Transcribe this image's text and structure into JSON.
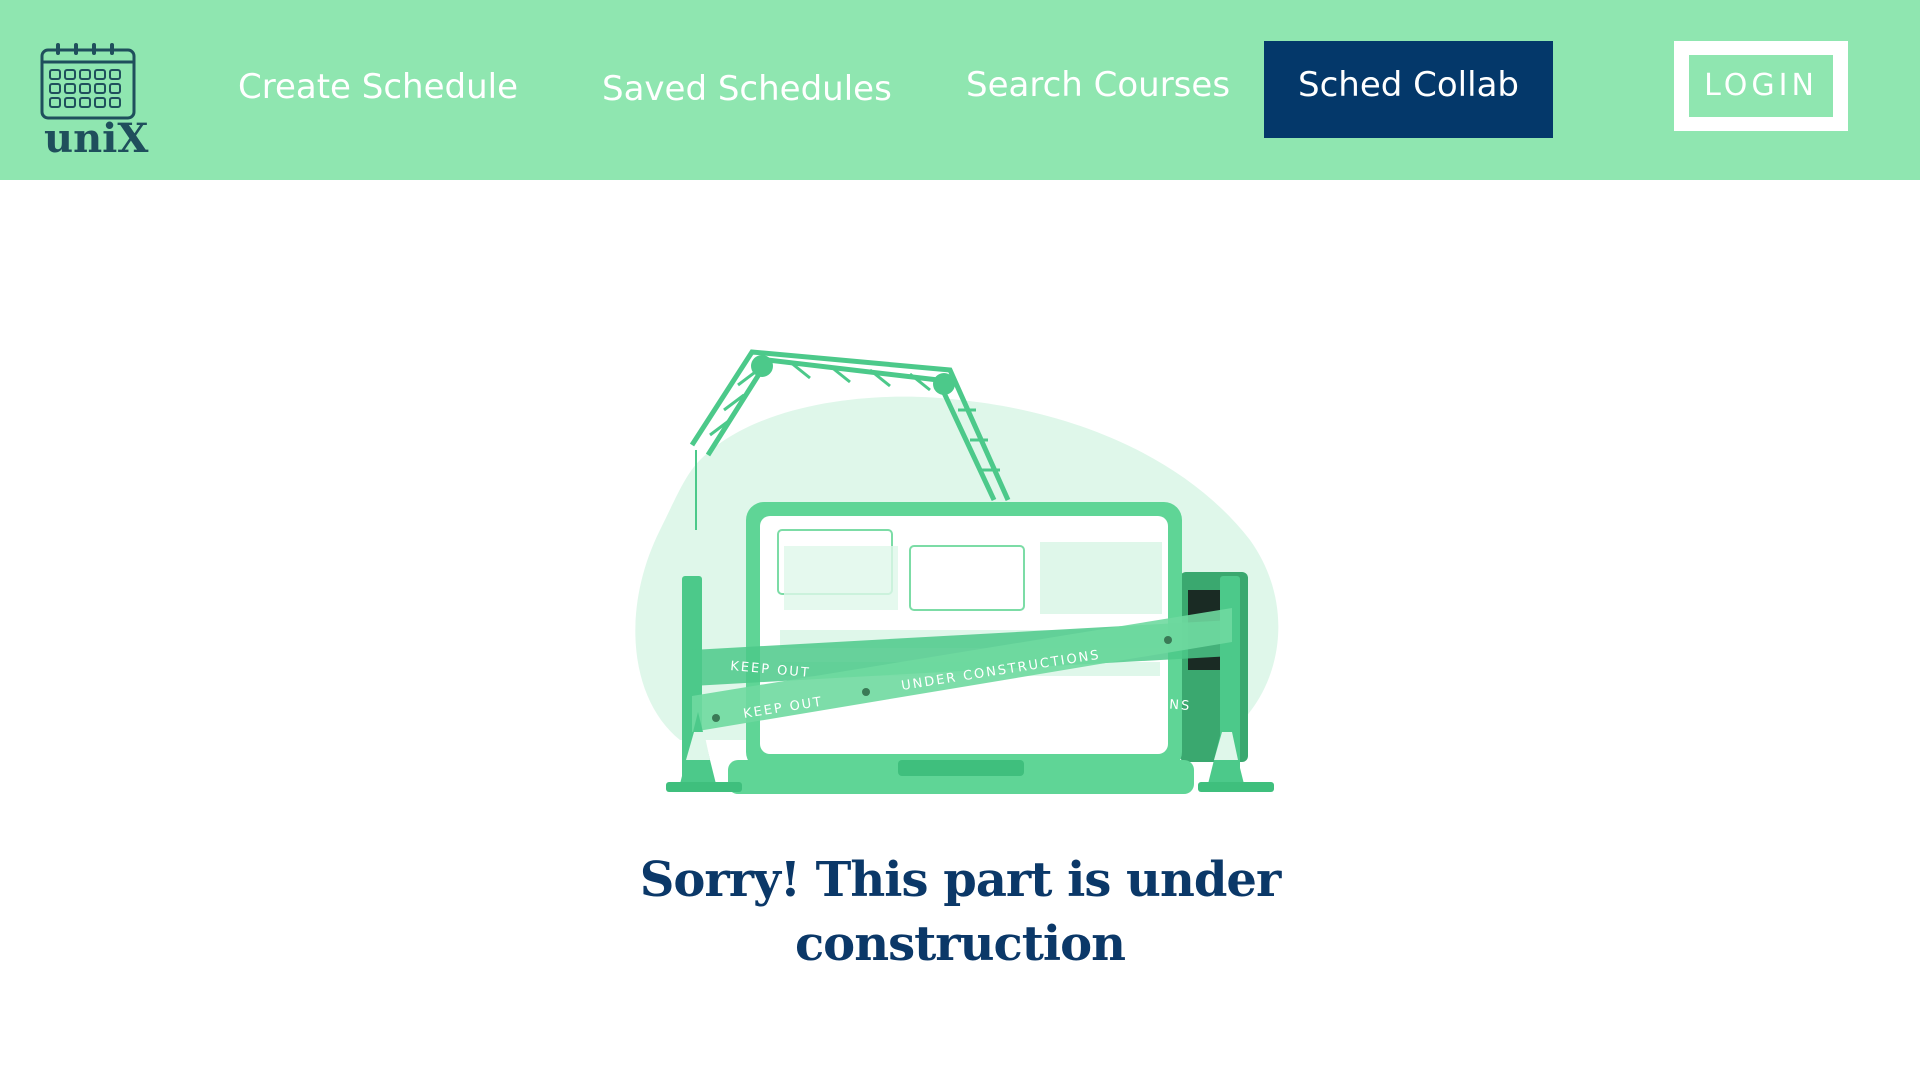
{
  "app": {
    "logo_text": "uniX",
    "logo_icon": "calendar-icon"
  },
  "nav": {
    "items": [
      {
        "label": "Create Schedule"
      },
      {
        "label": "Saved Schedules"
      },
      {
        "label": "Search Courses"
      },
      {
        "label": "Sched Collab",
        "active": true
      }
    ],
    "login_label": "LOGIN"
  },
  "main": {
    "illustration": "under-construction-illustration",
    "illustration_text": [
      "KEEP OUT",
      "UNDER CONSTRUCTIONS"
    ],
    "message": "Sorry! This part is under construction"
  },
  "colors": {
    "navbar": "#8fe6b0",
    "active_tab": "#04386a",
    "message_text": "#0b3868",
    "accent_green": "#4cc98a"
  }
}
